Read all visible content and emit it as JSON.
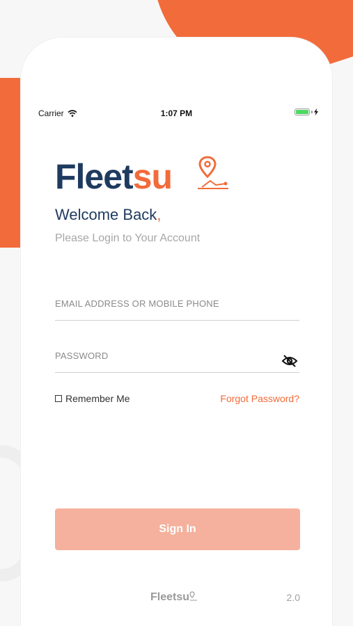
{
  "status_bar": {
    "carrier": "Carrier",
    "time": "1:07 PM"
  },
  "brand": {
    "logo_part1": "Fleet",
    "logo_part2": "su",
    "primary_color": "#1e3a5f",
    "accent_color": "#f26b3a"
  },
  "header": {
    "welcome": "Welcome Back",
    "welcome_comma": ",",
    "subtitle": "Please Login to Your Account"
  },
  "form": {
    "email_label": "EMAIL ADDRESS OR MOBILE PHONE",
    "password_label": "PASSWORD",
    "remember_label": "Remember Me",
    "forgot_label": "Forgot Password?",
    "signin_label": "Sign In"
  },
  "footer": {
    "logo_text": "Fleetsu",
    "version": "2.0"
  },
  "icons": [
    "wifi-icon",
    "battery-icon",
    "charging-icon",
    "location-pin-icon",
    "eye-slash-icon",
    "checkbox-icon"
  ]
}
